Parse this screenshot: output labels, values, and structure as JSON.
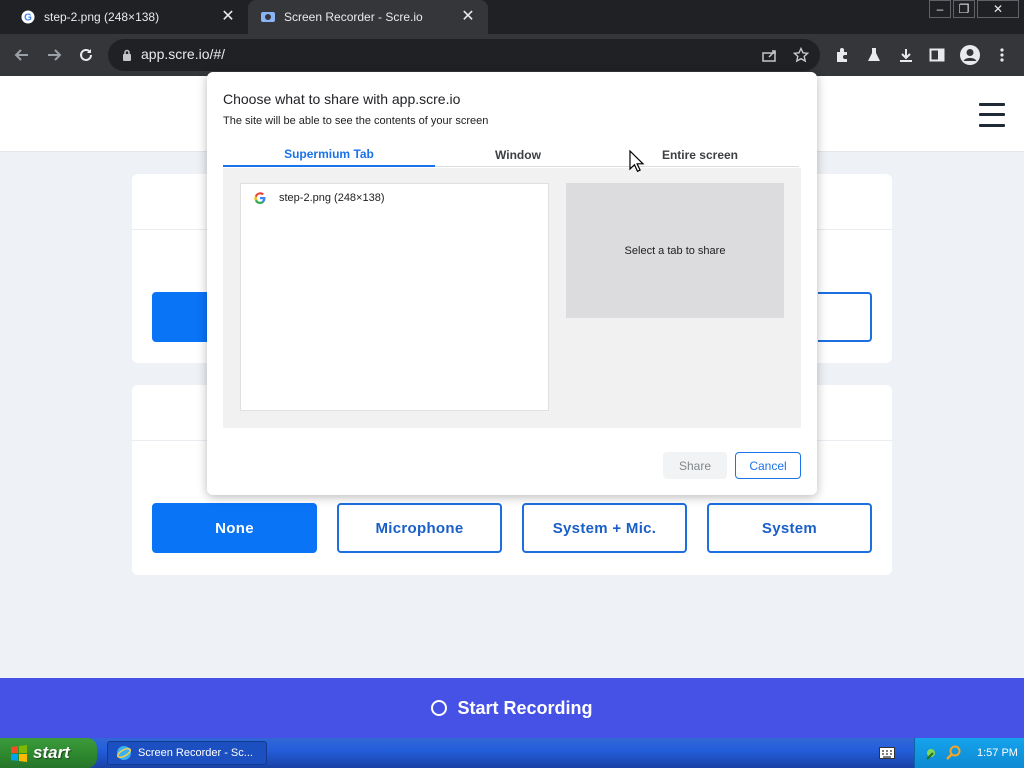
{
  "browser": {
    "tabs": [
      {
        "title": "step-2.png (248×138)",
        "favicon": "google-g-icon",
        "active": false
      },
      {
        "title": "Screen Recorder - Scre.io",
        "favicon": "screen-recorder-icon",
        "active": true
      }
    ],
    "address": "app.scre.io/#/"
  },
  "page": {
    "audio_options": [
      {
        "label": "None",
        "selected": true
      },
      {
        "label": "Microphone",
        "selected": false
      },
      {
        "label": "System + Mic.",
        "selected": false
      },
      {
        "label": "System",
        "selected": false
      }
    ],
    "start_recording_label": "Start Recording"
  },
  "share_dialog": {
    "title": "Choose what to share with app.scre.io",
    "subtitle": "The site will be able to see the contents of your screen",
    "tabs": [
      {
        "label": "Supermium Tab",
        "active": true
      },
      {
        "label": "Window",
        "active": false
      },
      {
        "label": "Entire screen",
        "active": false
      }
    ],
    "tab_items": [
      {
        "title": "step-2.png (248×138)",
        "icon": "google-g-icon"
      }
    ],
    "preview_text": "Select a tab to share",
    "share_label": "Share",
    "cancel_label": "Cancel"
  },
  "taskbar": {
    "start_label": "start",
    "task_label": "Screen Recorder - Sc...",
    "clock": "1:57 PM"
  },
  "colors": {
    "accent_blue": "#0a74f7",
    "start_bar": "#4652e6",
    "dialog_accent": "#1a73e8"
  }
}
